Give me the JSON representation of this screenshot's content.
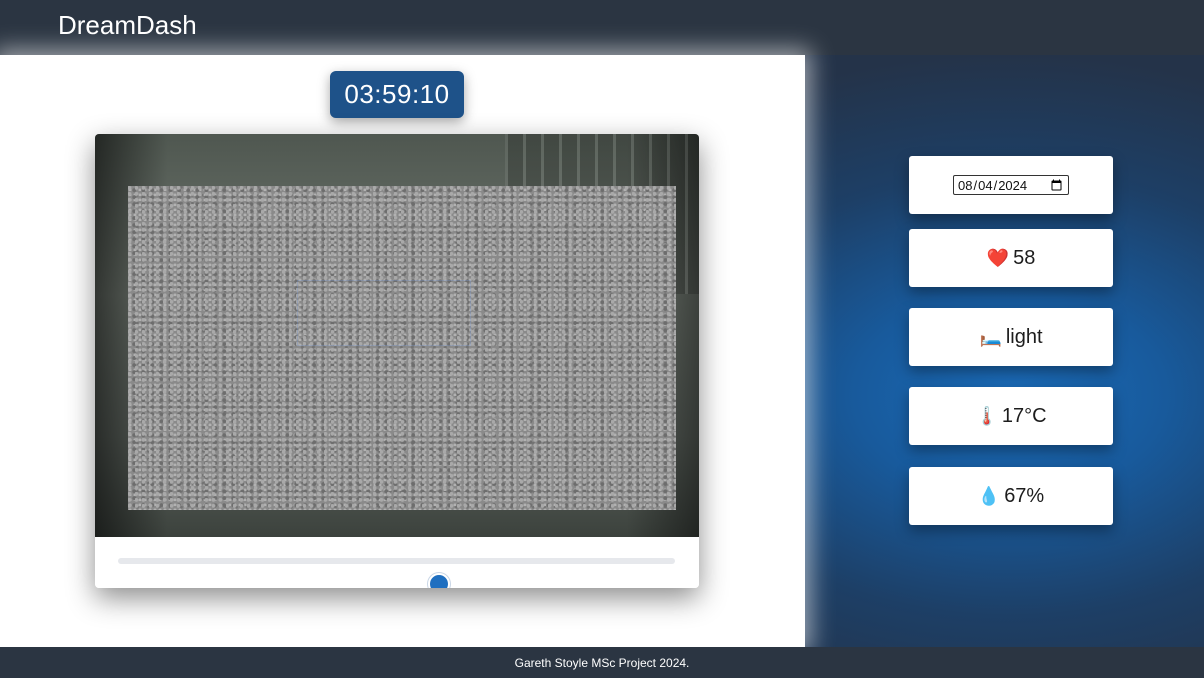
{
  "app": {
    "title": "DreamDash"
  },
  "timer": {
    "value": "03:59:10"
  },
  "player": {
    "position_fraction": 0.576
  },
  "sidebar": {
    "date": {
      "value": "2024-08-04"
    },
    "heart_rate": {
      "icon": "heart-icon",
      "glyph": "❤️",
      "value": "58"
    },
    "sleep_stage": {
      "icon": "bed-icon",
      "glyph": "🛏️",
      "value": "light"
    },
    "temperature": {
      "icon": "thermometer-icon",
      "glyph": "🌡️",
      "value": "17°C"
    },
    "humidity": {
      "icon": "droplet-icon",
      "glyph": "💧",
      "value": "67%"
    }
  },
  "footer": {
    "text": "Gareth Stoyle MSc Project 2024."
  },
  "colors": {
    "header": "#2b3542",
    "timer_bg": "#1e5289",
    "slider_thumb": "#1f6fc0",
    "backdrop_accent": "#1b6bb8"
  }
}
